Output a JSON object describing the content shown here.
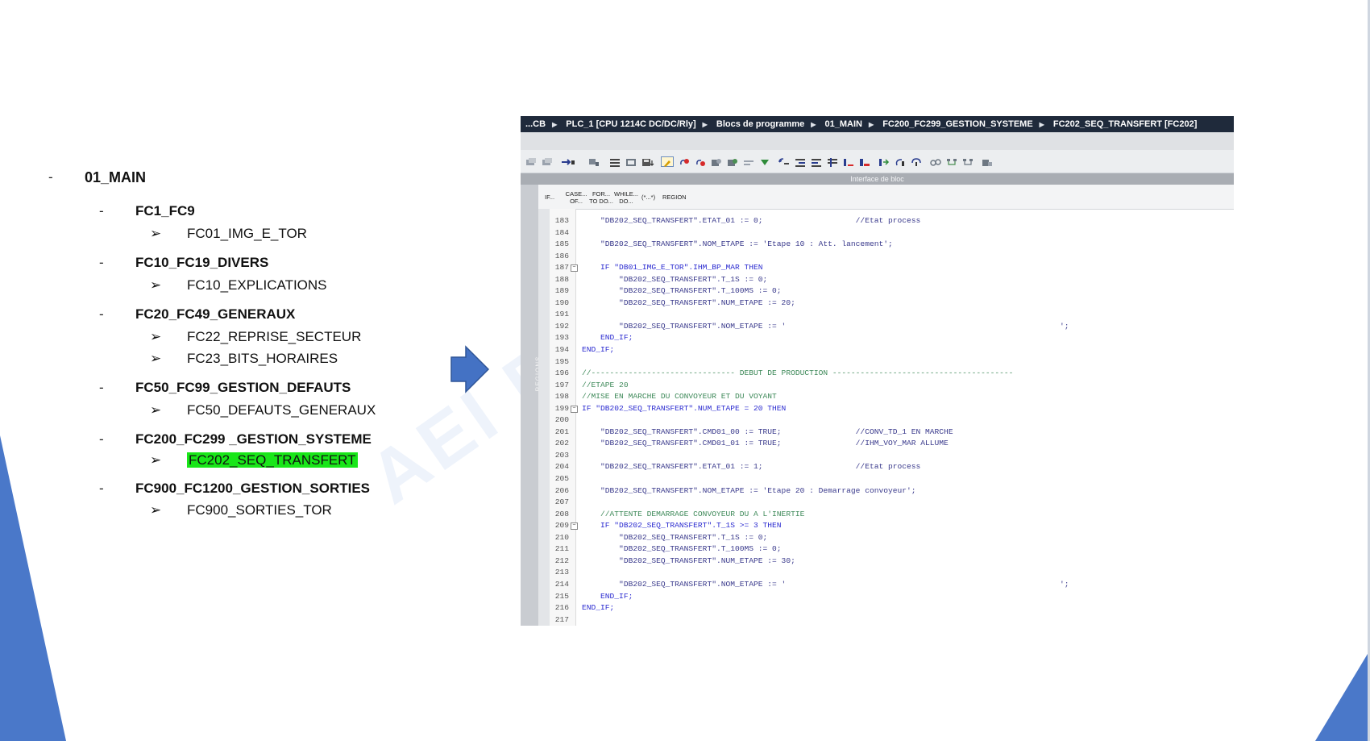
{
  "tree": {
    "root": "01_MAIN",
    "groups": [
      {
        "label": "FC1_FC9",
        "children": [
          "FC01_IMG_E_TOR"
        ]
      },
      {
        "label": "FC10_FC19_DIVERS",
        "children": [
          "FC10_EXPLICATIONS"
        ]
      },
      {
        "label": "FC20_FC49_GENERAUX",
        "children": [
          "FC22_REPRISE_SECTEUR",
          "FC23_BITS_HORAIRES"
        ]
      },
      {
        "label": "FC50_FC99_GESTION_DEFAUTS",
        "children": [
          "FC50_DEFAUTS_GENERAUX"
        ]
      },
      {
        "label": "FC200_FC299 _GESTION_SYSTEME",
        "children": [
          "FC202_SEQ_TRANSFERT"
        ]
      },
      {
        "label": "FC900_FC1200_GESTION_SORTIES",
        "children": [
          "FC900_SORTIES_TOR"
        ]
      }
    ],
    "highlighted": "FC202_SEQ_TRANSFERT",
    "highlight_color": "#19e619"
  },
  "ide": {
    "breadcrumb": [
      "...CB",
      "PLC_1 [CPU 1214C DC/DC/Rly]",
      "Blocs de programme",
      "01_MAIN",
      "FC200_FC299_GESTION_SYSTEME",
      "FC202_SEQ_TRANSFERT [FC202]"
    ],
    "interface_label": "Interface de bloc",
    "regions_label": "REGIONS",
    "scl_ops": [
      "IF...",
      "CASE... OF...",
      "FOR... TO DO...",
      "WHILE... DO...",
      "(*...*)",
      "REGION"
    ],
    "code_lines": [
      {
        "n": "183",
        "text": "    \"DB202_SEQ_TRANSFERT\".ETAT_01 := 0;                    //Etat process"
      },
      {
        "n": "184",
        "text": ""
      },
      {
        "n": "185",
        "text": "    \"DB202_SEQ_TRANSFERT\".NOM_ETAPE := 'Etape 10 : Att. lancement';"
      },
      {
        "n": "186",
        "text": ""
      },
      {
        "n": "187",
        "text": "    IF \"DB01_IMG_E_TOR\".IHM_BP_MAR THEN"
      },
      {
        "n": "188",
        "text": "        \"DB202_SEQ_TRANSFERT\".T_1S := 0;"
      },
      {
        "n": "189",
        "text": "        \"DB202_SEQ_TRANSFERT\".T_100MS := 0;"
      },
      {
        "n": "190",
        "text": "        \"DB202_SEQ_TRANSFERT\".NUM_ETAPE := 20;"
      },
      {
        "n": "191",
        "text": ""
      },
      {
        "n": "192",
        "text": "        \"DB202_SEQ_TRANSFERT\".NOM_ETAPE := '                                                           ';"
      },
      {
        "n": "193",
        "text": "    END_IF;"
      },
      {
        "n": "194",
        "text": "END_IF;"
      },
      {
        "n": "195",
        "text": ""
      },
      {
        "n": "196",
        "text": "//------------------------------- DEBUT DE PRODUCTION ---------------------------------------"
      },
      {
        "n": "197",
        "text": "//ETAPE 20"
      },
      {
        "n": "198",
        "text": "//MISE EN MARCHE DU CONVOYEUR ET DU VOYANT"
      },
      {
        "n": "199",
        "text": "IF \"DB202_SEQ_TRANSFERT\".NUM_ETAPE = 20 THEN"
      },
      {
        "n": "200",
        "text": ""
      },
      {
        "n": "201",
        "text": "    \"DB202_SEQ_TRANSFERT\".CMD01_00 := TRUE;                //CONV_TD_1 EN MARCHE"
      },
      {
        "n": "202",
        "text": "    \"DB202_SEQ_TRANSFERT\".CMD01_01 := TRUE;                //IHM_VOY_MAR ALLUME"
      },
      {
        "n": "203",
        "text": ""
      },
      {
        "n": "204",
        "text": "    \"DB202_SEQ_TRANSFERT\".ETAT_01 := 1;                    //Etat process"
      },
      {
        "n": "205",
        "text": ""
      },
      {
        "n": "206",
        "text": "    \"DB202_SEQ_TRANSFERT\".NOM_ETAPE := 'Etape 20 : Demarrage convoyeur';"
      },
      {
        "n": "207",
        "text": ""
      },
      {
        "n": "208",
        "text": "    //ATTENTE DEMARRAGE CONVOYEUR DU A L'INERTIE"
      },
      {
        "n": "209",
        "text": "    IF \"DB202_SEQ_TRANSFERT\".T_1S >= 3 THEN"
      },
      {
        "n": "210",
        "text": "        \"DB202_SEQ_TRANSFERT\".T_1S := 0;"
      },
      {
        "n": "211",
        "text": "        \"DB202_SEQ_TRANSFERT\".T_100MS := 0;"
      },
      {
        "n": "212",
        "text": "        \"DB202_SEQ_TRANSFERT\".NUM_ETAPE := 30;"
      },
      {
        "n": "213",
        "text": ""
      },
      {
        "n": "214",
        "text": "        \"DB202_SEQ_TRANSFERT\".NOM_ETAPE := '                                                           ';"
      },
      {
        "n": "215",
        "text": "    END_IF;"
      },
      {
        "n": "216",
        "text": "END_IF;"
      },
      {
        "n": "217",
        "text": ""
      }
    ],
    "fold_lines": [
      "187",
      "199",
      "209"
    ]
  },
  "watermark": "AEI F",
  "colors": {
    "accent_blue": "#4472c4",
    "breadcrumb_bg": "#1f2a3b"
  }
}
